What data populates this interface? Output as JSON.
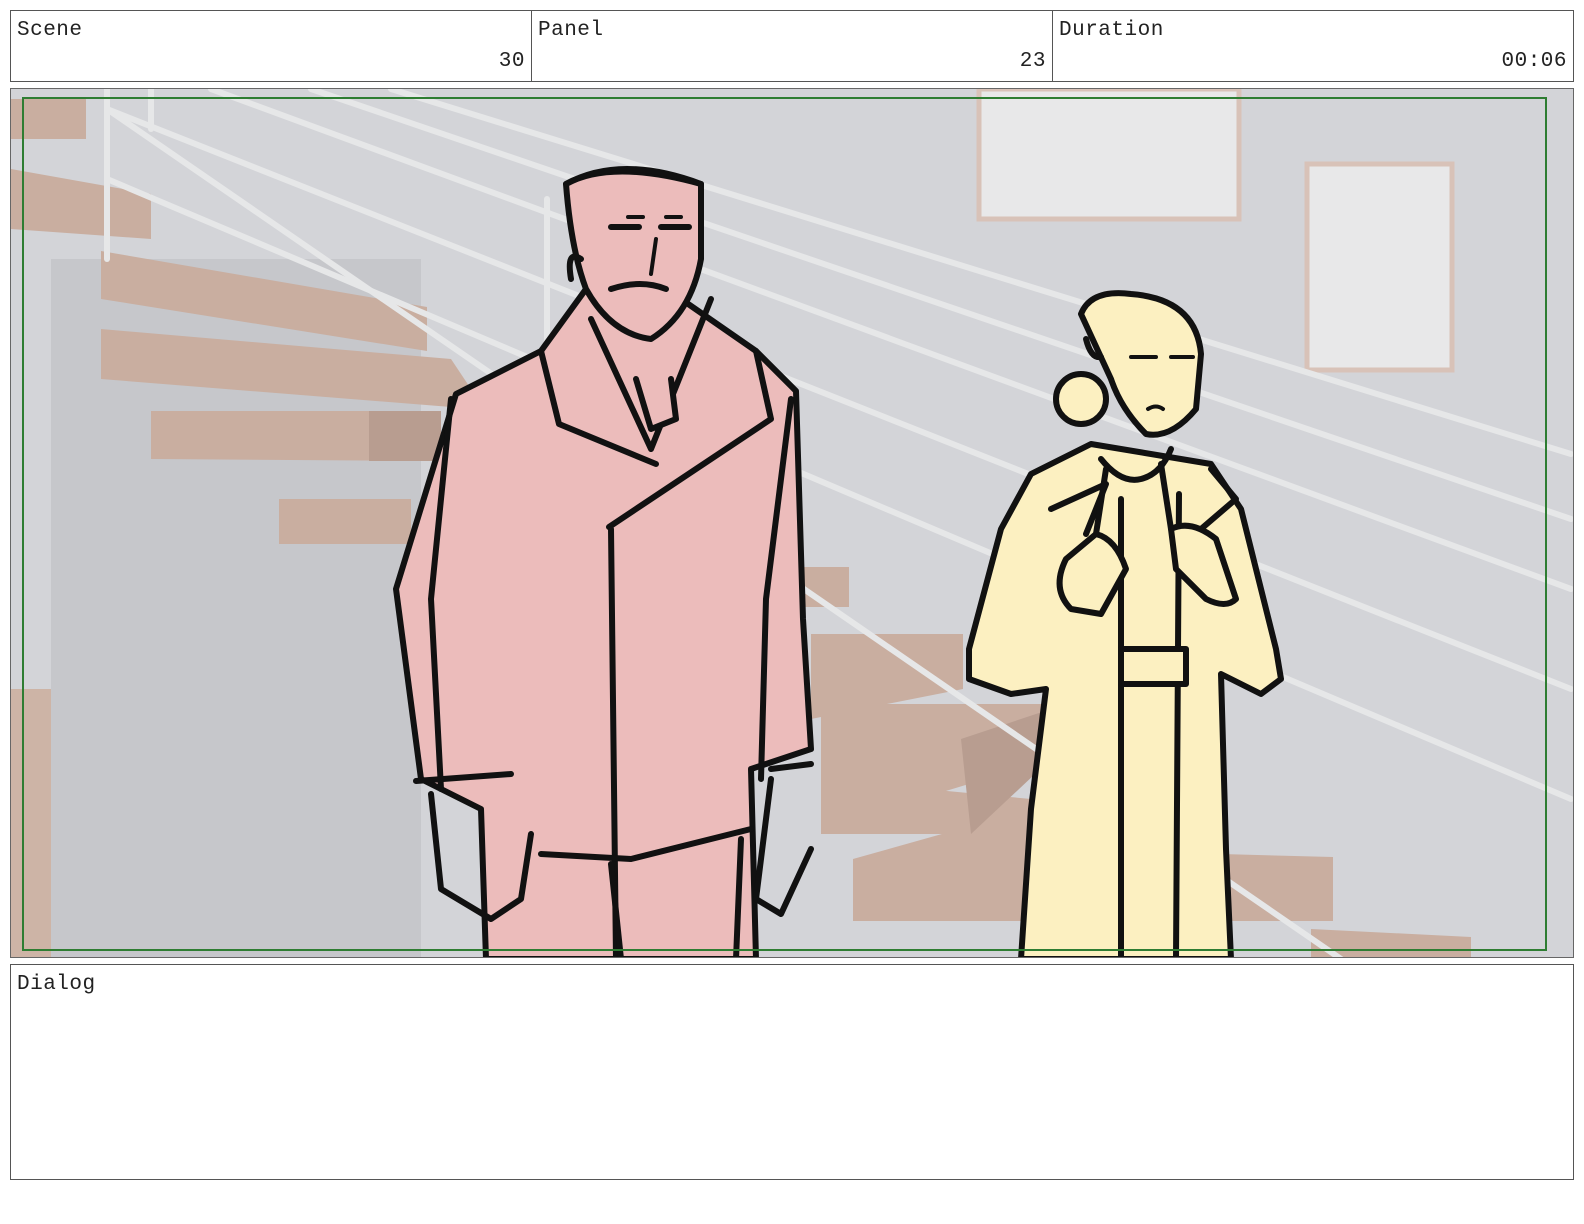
{
  "header": {
    "scene": {
      "label": "Scene",
      "value": "30"
    },
    "panel": {
      "label": "Panel",
      "value": "23"
    },
    "duration": {
      "label": "Duration",
      "value": "00:06"
    }
  },
  "dialog": {
    "label": "Dialog",
    "text": ""
  },
  "colors": {
    "frame_border": "#2e7d32",
    "background_wall": "#d3d4d8",
    "stairs": "#c9aea0",
    "man_coat": "#ecbcbb",
    "woman_coat": "#fcf0c1",
    "ink": "#111111"
  }
}
